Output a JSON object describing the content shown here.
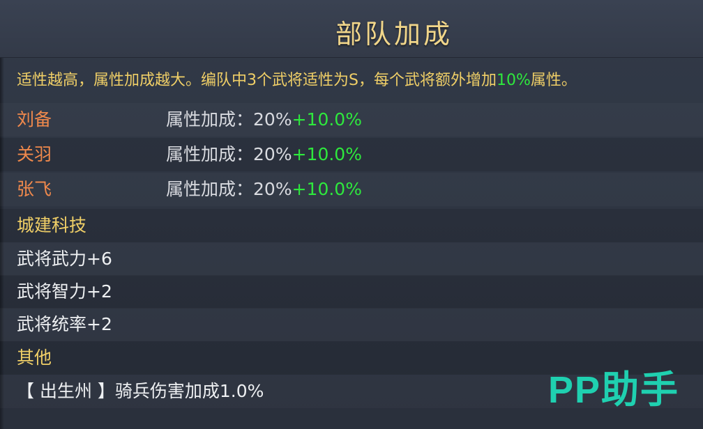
{
  "header": {
    "title": "部队加成"
  },
  "description": {
    "part1": "适性越高，属性加成越大。编队中3个武将适性为S，每个武将额外增加",
    "highlight": "10%",
    "part2": "属性。"
  },
  "generals": [
    {
      "name": "刘备",
      "bonus_label": "属性加成：",
      "base": "20%",
      "extra": "+10.0%"
    },
    {
      "name": "关羽",
      "bonus_label": "属性加成：",
      "base": "20%",
      "extra": "+10.0%"
    },
    {
      "name": "张飞",
      "bonus_label": "属性加成：",
      "base": "20%",
      "extra": "+10.0%"
    }
  ],
  "city_tech": {
    "title": "城建科技",
    "items": [
      "武将武力+6",
      "武将智力+2",
      "武将统率+2"
    ]
  },
  "other": {
    "title": "其他",
    "items": [
      "【 出生州 】骑兵伤害加成1.0%"
    ]
  },
  "watermark": {
    "text": "PP助手"
  },
  "colors": {
    "title": "#f1d68a",
    "section": "#f0cf67",
    "general_name": "#f0894c",
    "green": "#2ee83d",
    "watermark": "#1fd0b0"
  }
}
